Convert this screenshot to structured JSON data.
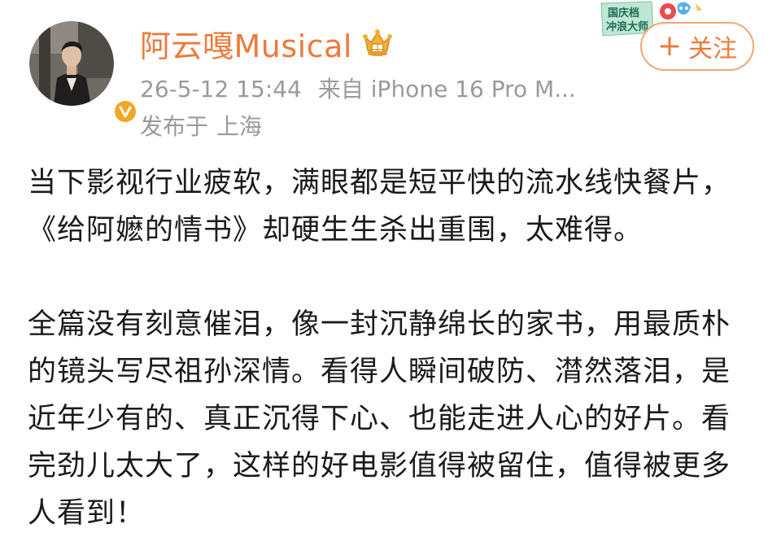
{
  "header": {
    "username": "阿云嘎Musical",
    "timestamp": "26-5-12 15:44",
    "source": "来自 iPhone 16 Pro M...",
    "location_prefix": "发布于",
    "location": "上海",
    "follow_label": "关注",
    "follow_icon": "plus-icon",
    "event_badge": {
      "line1": "国庆档",
      "line2": "冲浪大师"
    }
  },
  "colors": {
    "username": "#ee7a3a",
    "meta": "#9a9a9a",
    "follow_border": "#f2a774",
    "body_text": "#1b1b1b",
    "verified_badge": "#f5a623"
  },
  "post": {
    "paragraphs": [
      "当下影视行业疲软，满眼都是短平快的流水线快餐片，《给阿嬷的情书》却硬生生杀出重围，太难得。",
      "全篇没有刻意催泪，像一封沉静绵长的家书，用最质朴的镜头写尽祖孙深情。看得人瞬间破防、潸然落泪，是近年少有的、真正沉得下心、也能走进人心的好片。看完劲儿太大了，这样的好电影值得被留住，值得被更多人看到！"
    ]
  }
}
